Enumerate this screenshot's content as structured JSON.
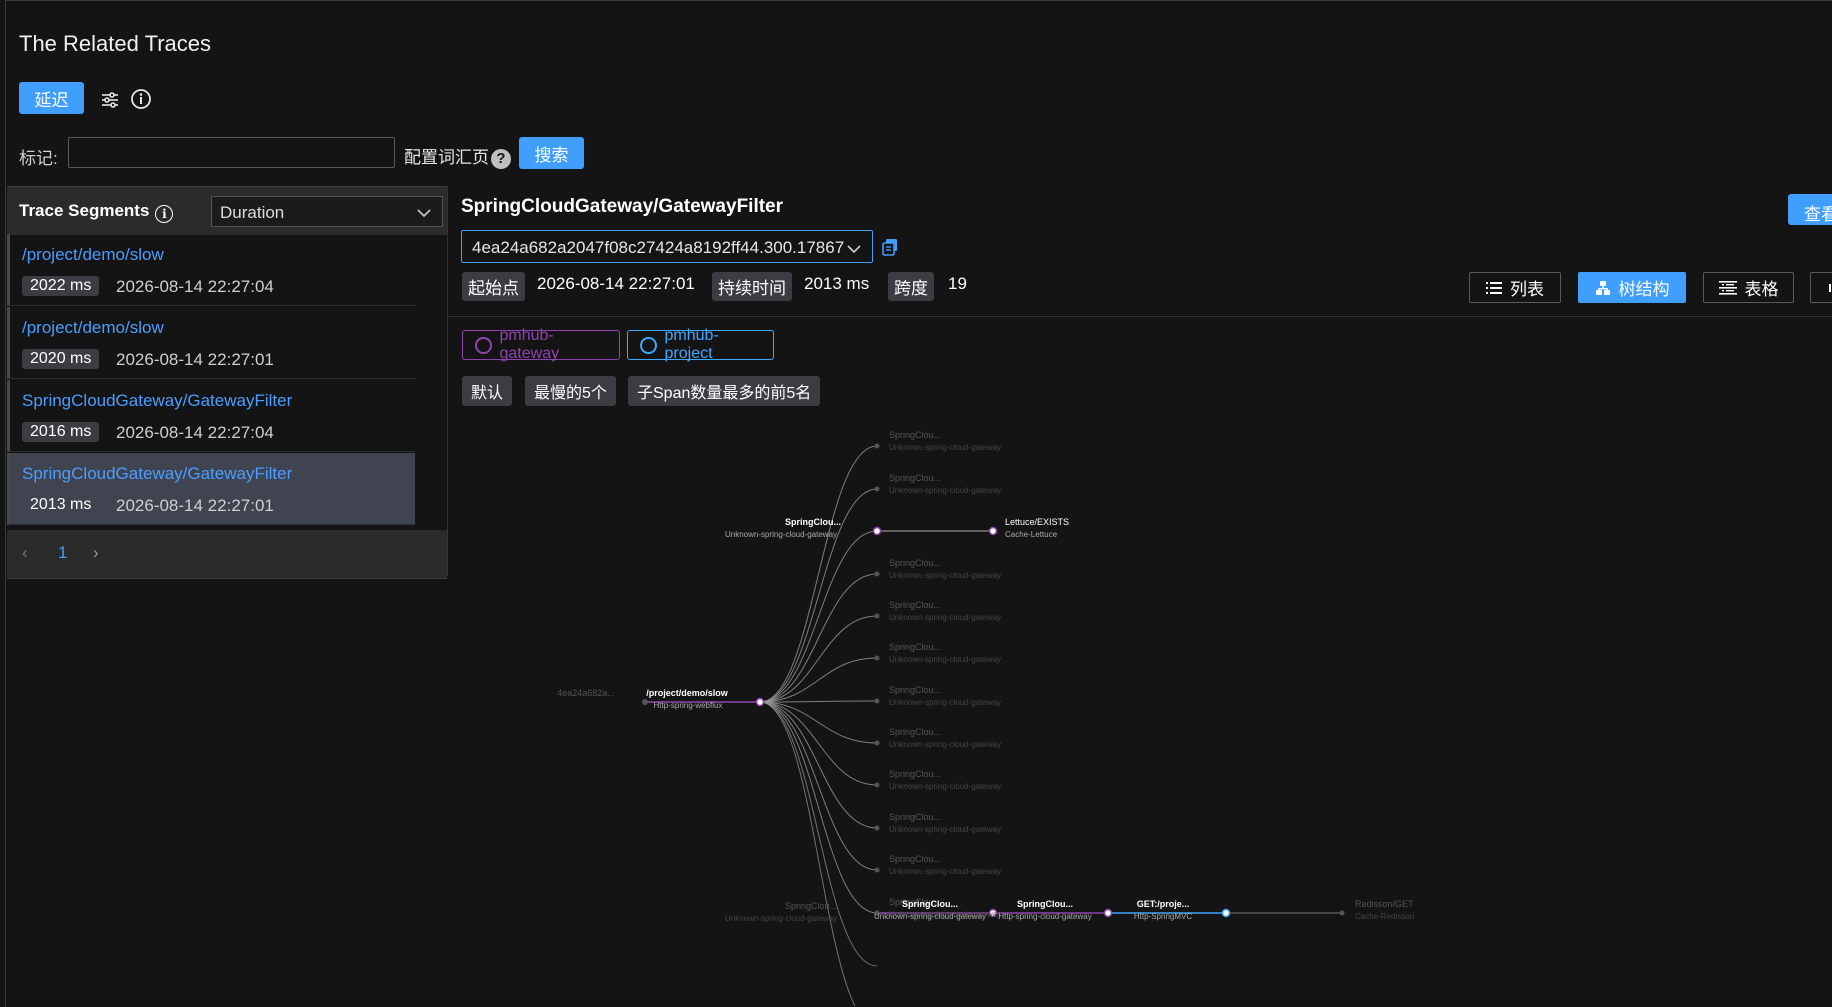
{
  "page": {
    "title": "The Related Traces",
    "delay_button": "延迟",
    "tag_label": "标记:",
    "tag_input_value": "",
    "config_label": "配置词汇页",
    "search_button": "搜索"
  },
  "segments": {
    "header": "Trace Segments",
    "sort_value": "Duration",
    "items": [
      {
        "name": "/project/demo/slow",
        "duration": "2022 ms",
        "time": "2026-08-14 22:27:04",
        "selected": false
      },
      {
        "name": "/project/demo/slow",
        "duration": "2020 ms",
        "time": "2026-08-14 22:27:01",
        "selected": false
      },
      {
        "name": "SpringCloudGateway/GatewayFilter",
        "duration": "2016 ms",
        "time": "2026-08-14 22:27:04",
        "selected": false
      },
      {
        "name": "SpringCloudGateway/GatewayFilter",
        "duration": "2013 ms",
        "time": "2026-08-14 22:27:01",
        "selected": true
      }
    ],
    "pager": {
      "prev": "‹",
      "page": "1",
      "next": "›"
    }
  },
  "detail": {
    "title": "SpringCloudGateway/GatewayFilter",
    "view_button": "查看",
    "trace_id": "4ea24a682a2047f08c27424a8192ff44.300.17867",
    "start_label": "起始点",
    "start_value": "2026-08-14 22:27:01",
    "duration_label": "持续时间",
    "duration_value": "2013 ms",
    "span_label": "跨度",
    "span_value": "19",
    "modes": {
      "list": "列表",
      "tree": "树结构",
      "table": "表格"
    },
    "services": [
      {
        "name": "pmhub-gateway",
        "color": "#8e44ad"
      },
      {
        "name": "pmhub-project",
        "color": "#3fa7ff"
      }
    ],
    "filters": [
      "默认",
      "最慢的5个",
      "子Span数量最多的前5名"
    ]
  },
  "tree": {
    "root_label": "4ea24a682a...",
    "main_node": {
      "name": "/project/demo/slow",
      "type": "Http-spring-webflux"
    },
    "active_top": {
      "name": "SpringClou...",
      "type": "Unknown-spring-cloud-gateway"
    },
    "lettuce": {
      "name": "Lettuce/EXISTS",
      "type": "Cache-Lettuce"
    },
    "faded_child": {
      "name": "SpringClou...",
      "type": "Unknown-spring-cloud-gateway"
    },
    "bottom_faded": {
      "name": "SpringClou...",
      "type": "Unknown-spring-cloud-gateway"
    },
    "chain": [
      {
        "name": "SpringClou...",
        "type": "Unknown-spring-cloud-gateway"
      },
      {
        "name": "SpringClou...",
        "type": "Http-spring-cloud-gateway"
      },
      {
        "name": "GET:/proje...",
        "type": "Http-SpringMVC"
      },
      {
        "name": "Redisson/GET",
        "type": "Cache-Redisson"
      }
    ]
  },
  "colors": {
    "accent": "#409eff",
    "gateway": "#8e44ad",
    "project": "#3fa7ff"
  }
}
